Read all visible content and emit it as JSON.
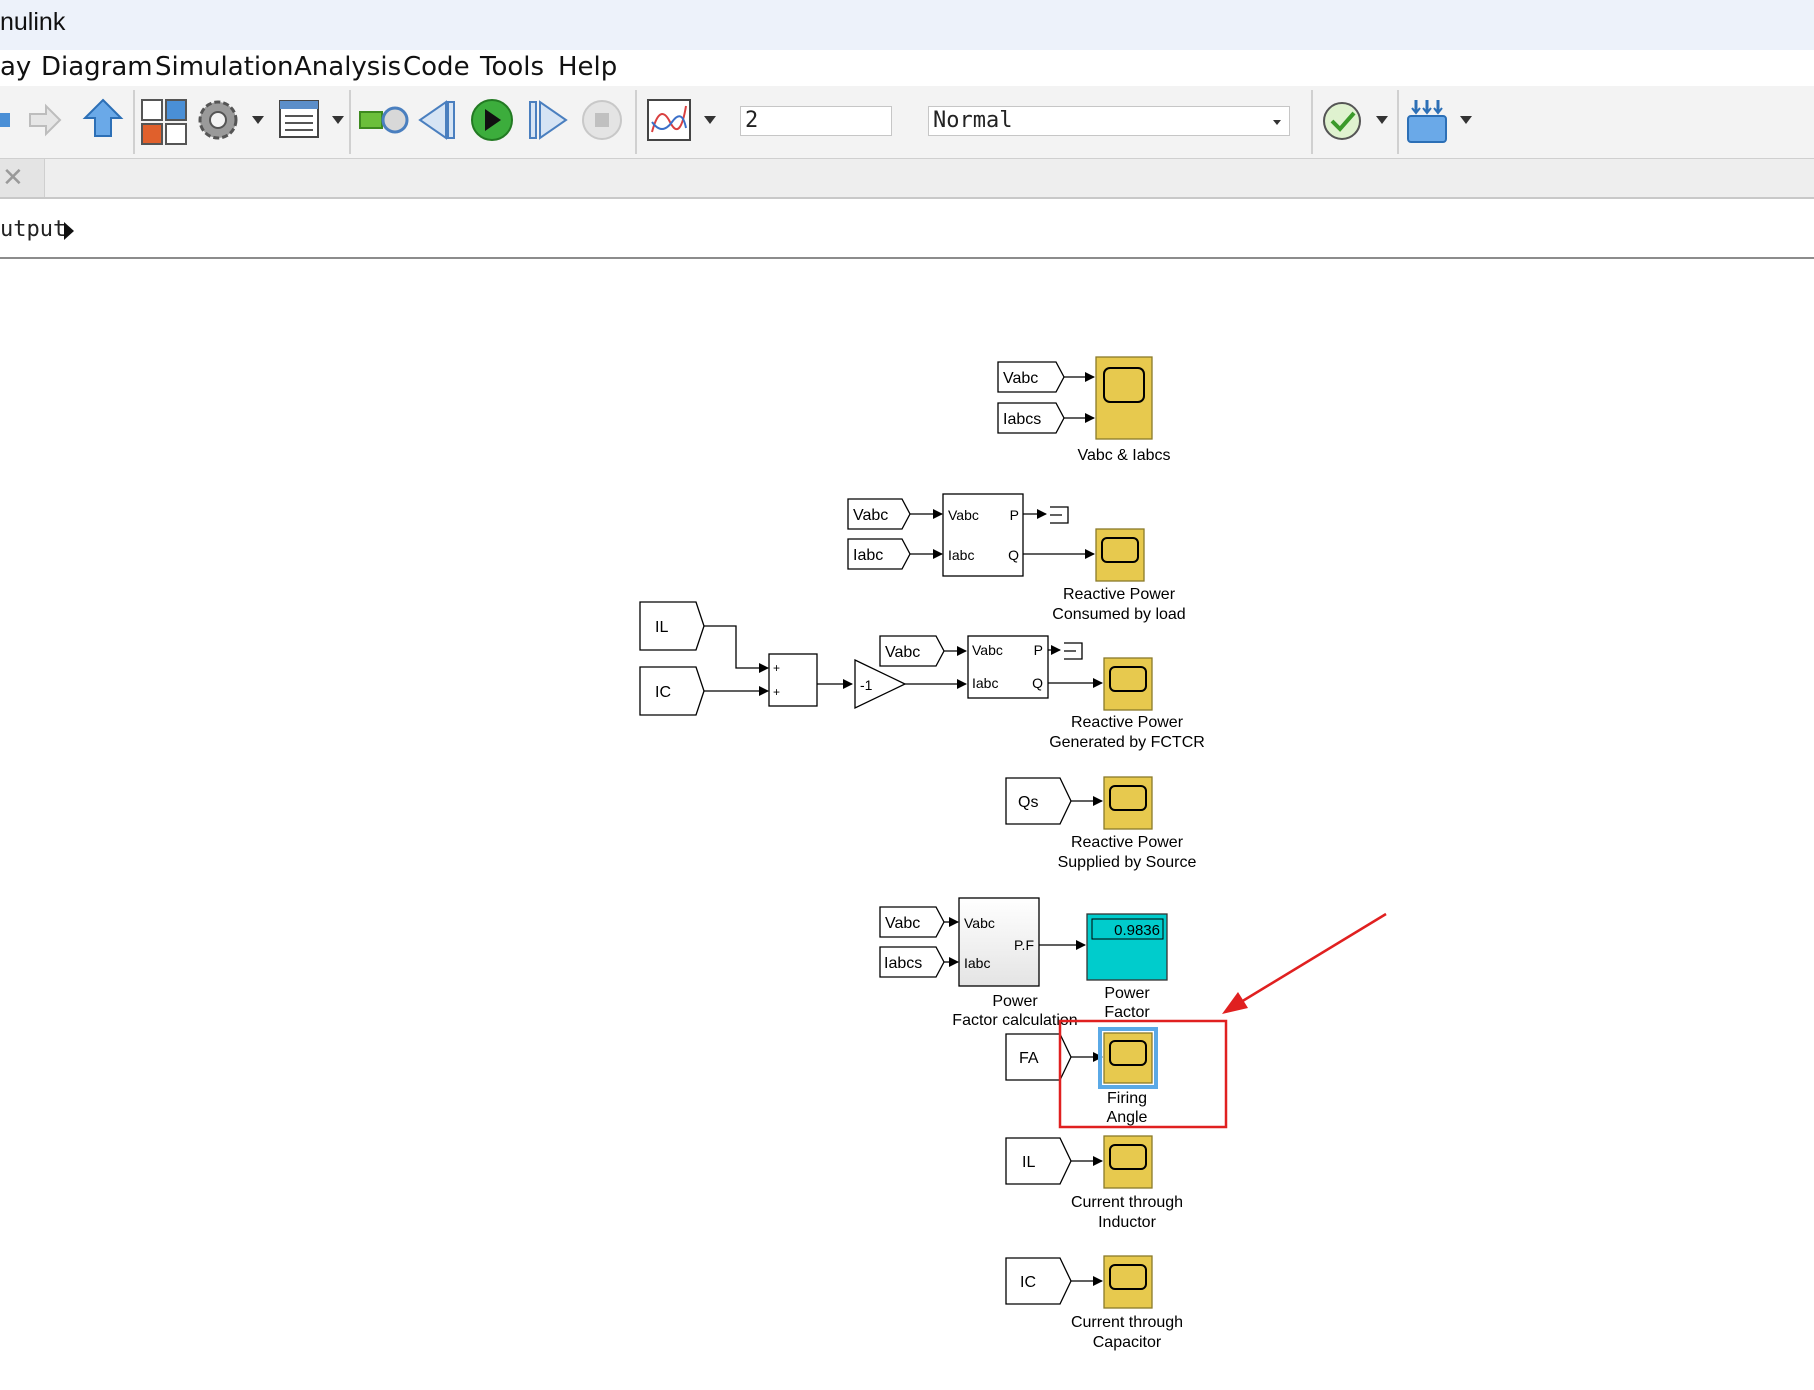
{
  "window": {
    "title": "nulink"
  },
  "menu": [
    "ay",
    "Diagram",
    "Simulation",
    "Analysis",
    "Code",
    "Tools",
    "Help"
  ],
  "toolbar": {
    "stop_time": "2",
    "sim_mode": "Normal",
    "icons": [
      "back-icon",
      "forward-icon",
      "up-icon",
      "library-browser-icon",
      "settings-icon",
      "model-explorer-icon",
      "step-back-icon",
      "run-icon",
      "step-forward-icon",
      "stop-icon",
      "scope-data-icon",
      "check-icon",
      "build-icon"
    ]
  },
  "tab": {
    "close": "✕"
  },
  "breadcrumb": {
    "label": "utput"
  },
  "blocks": {
    "s1_label": "Vabc & Iabcs",
    "g1_vabc": "Vabc",
    "g1_iabcs": "Iabcs",
    "g2_vabc": "Vabc",
    "g2_iabc": "Iabc",
    "pq1_in1": "Vabc",
    "pq1_in2": "Iabc",
    "pq1_out1": "P",
    "pq1_out2": "Q",
    "s2_label1": "Reactive Power",
    "s2_label2": "Consumed by load",
    "g_il": "IL",
    "g_ic": "IC",
    "sum_p1": "+",
    "sum_p2": "+",
    "gain": "-1",
    "g3_vabc": "Vabc",
    "pq2_in1": "Vabc",
    "pq2_in2": "Iabc",
    "pq2_out1": "P",
    "pq2_out2": "Q",
    "s3_label1": "Reactive Power",
    "s3_label2": "Generated by FCTCR",
    "g_qs": "Qs",
    "s4_label1": "Reactive Power",
    "s4_label2": "Supplied by Source",
    "g4_vabc": "Vabc",
    "g4_iabcs": "Iabcs",
    "pf_in1": "Vabc",
    "pf_in2": "Iabc",
    "pf_out": "P.F",
    "pf_label1": "Power",
    "pf_label2": "Factor calculation",
    "display_value": "0.9836",
    "display_label1": "Power",
    "display_label2": "Factor",
    "g_fa": "FA",
    "s5_label1": "Firing",
    "s5_label2": "Angle",
    "g_il2": "IL",
    "s6_label1": "Current through",
    "s6_label2": "Inductor",
    "g_ic2": "IC",
    "s7_label1": "Current through",
    "s7_label2": "Capacitor"
  },
  "colors": {
    "scope": "#e7c94e",
    "display": "#00cccc",
    "highlight": "#e02020",
    "selection": "#5aa9e6"
  }
}
